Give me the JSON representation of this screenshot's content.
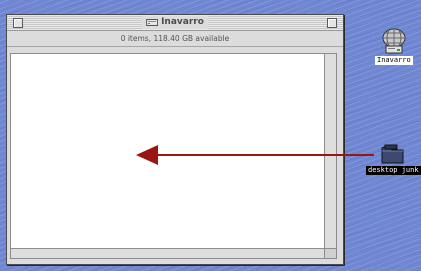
{
  "window": {
    "title": "Inavarro",
    "info": "0 items, 118.40 GB available"
  },
  "desktop": {
    "icons": [
      {
        "label": "Inavarro",
        "icon": "hard-disk-icon",
        "selected": false
      },
      {
        "label": "desktop junk",
        "icon": "folder-icon",
        "selected": true
      }
    ]
  },
  "annotation": {
    "arrow_color": "#9b1515",
    "meaning": "drag folder into window"
  }
}
